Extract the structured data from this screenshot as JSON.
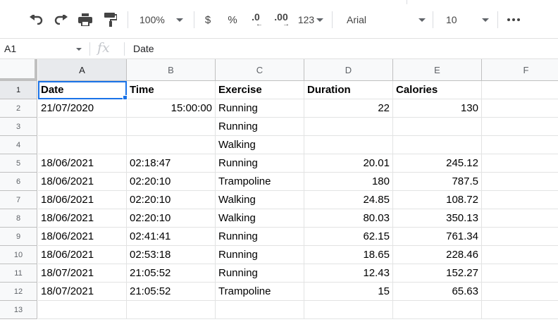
{
  "toolbar": {
    "zoom": "100%",
    "currency": "$",
    "percent": "%",
    "decrease_decimal": ".0",
    "increase_decimal": ".00",
    "number_format": "123",
    "font": "Arial",
    "font_size": "10",
    "icons": [
      "undo-icon",
      "redo-icon",
      "print-icon",
      "paint-format-icon",
      "more-icon"
    ]
  },
  "formula_bar": {
    "name_box": "A1",
    "fx": "fx",
    "value": "Date"
  },
  "sheet": {
    "selected_cell": "A1",
    "columns": [
      "A",
      "B",
      "C",
      "D",
      "E",
      "F"
    ],
    "rows": [
      {
        "num": "1",
        "cells": [
          "Date",
          "Time",
          "Exercise",
          "Duration",
          "Calories",
          ""
        ]
      },
      {
        "num": "2",
        "cells": [
          "21/07/2020",
          "15:00:00",
          "Running",
          "22",
          "130",
          ""
        ]
      },
      {
        "num": "3",
        "cells": [
          "",
          "",
          "Running",
          "",
          "",
          ""
        ]
      },
      {
        "num": "4",
        "cells": [
          "",
          "",
          "Walking",
          "",
          "",
          ""
        ]
      },
      {
        "num": "5",
        "cells": [
          "18/06/2021",
          "02:18:47",
          "Running",
          "20.01",
          "245.12",
          ""
        ]
      },
      {
        "num": "6",
        "cells": [
          "18/06/2021",
          "02:20:10",
          "Trampoline",
          "180",
          "787.5",
          ""
        ]
      },
      {
        "num": "7",
        "cells": [
          "18/06/2021",
          "02:20:10",
          "Walking",
          "24.85",
          "108.72",
          ""
        ]
      },
      {
        "num": "8",
        "cells": [
          "18/06/2021",
          "02:20:10",
          "Walking",
          "80.03",
          "350.13",
          ""
        ]
      },
      {
        "num": "9",
        "cells": [
          "18/06/2021",
          "02:41:41",
          "Running",
          "62.15",
          "761.34",
          ""
        ]
      },
      {
        "num": "10",
        "cells": [
          "18/06/2021",
          "02:53:18",
          "Running",
          "18.65",
          "228.46",
          ""
        ]
      },
      {
        "num": "11",
        "cells": [
          "18/07/2021",
          "21:05:52",
          "Running",
          "12.43",
          "152.27",
          ""
        ]
      },
      {
        "num": "12",
        "cells": [
          "18/07/2021",
          "21:05:52",
          "Trampoline",
          "15",
          "65.63",
          ""
        ]
      },
      {
        "num": "13",
        "cells": [
          "",
          "",
          "",
          "",
          "",
          ""
        ]
      }
    ]
  },
  "colors": {
    "selection": "#1a73e8",
    "header_bg": "#f8f9fa",
    "gridline": "#e2e3e3"
  }
}
